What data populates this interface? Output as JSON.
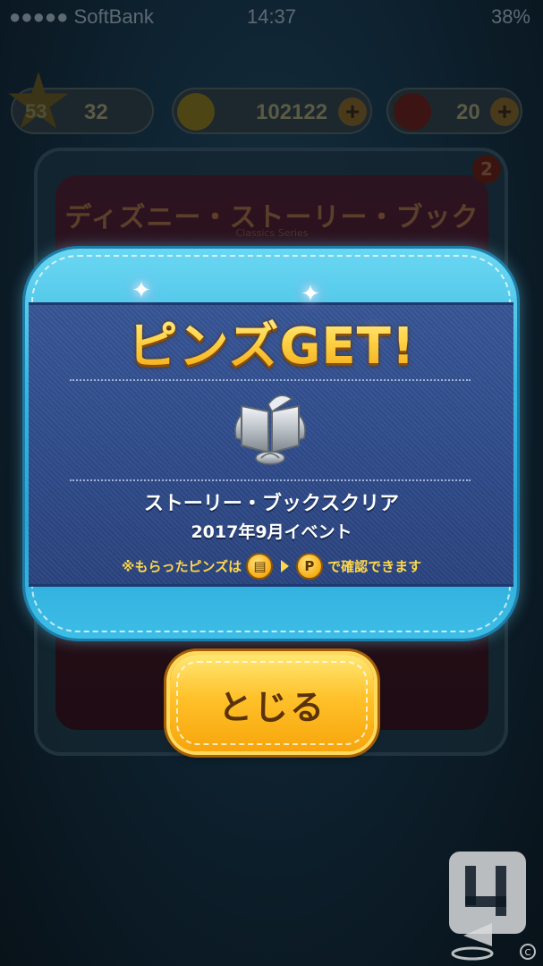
{
  "status_bar": {
    "carrier": "●●●●● SoftBank",
    "time": "14:37",
    "battery": "38%"
  },
  "hud": {
    "level": "53",
    "level_progress": "32",
    "coins": "102122",
    "hearts": "20",
    "plus": "+"
  },
  "background": {
    "book_title": "ディズニー・ストーリー・ブックス",
    "book_subtitle": "Classics Series",
    "badge_count": "2"
  },
  "modal": {
    "title": "ピンズGET!",
    "pin_name": "ストーリー・ブックスクリア",
    "pin_event": "2017年9月イベント",
    "notice_prefix": "※もらったピンズは",
    "notice_suffix": "で確認できます",
    "close_label": "とじる"
  },
  "colors": {
    "modal_frame": "#37b6e1",
    "modal_panel": "#2f4b8a",
    "title_gold": "#ffd54a",
    "notice_yellow": "#ffd84a",
    "button_orange": "#ffc12a"
  },
  "icons": {
    "pin": "open-book-badge-icon",
    "menu": "document-icon",
    "pins_collection": "p-coin-icon"
  }
}
